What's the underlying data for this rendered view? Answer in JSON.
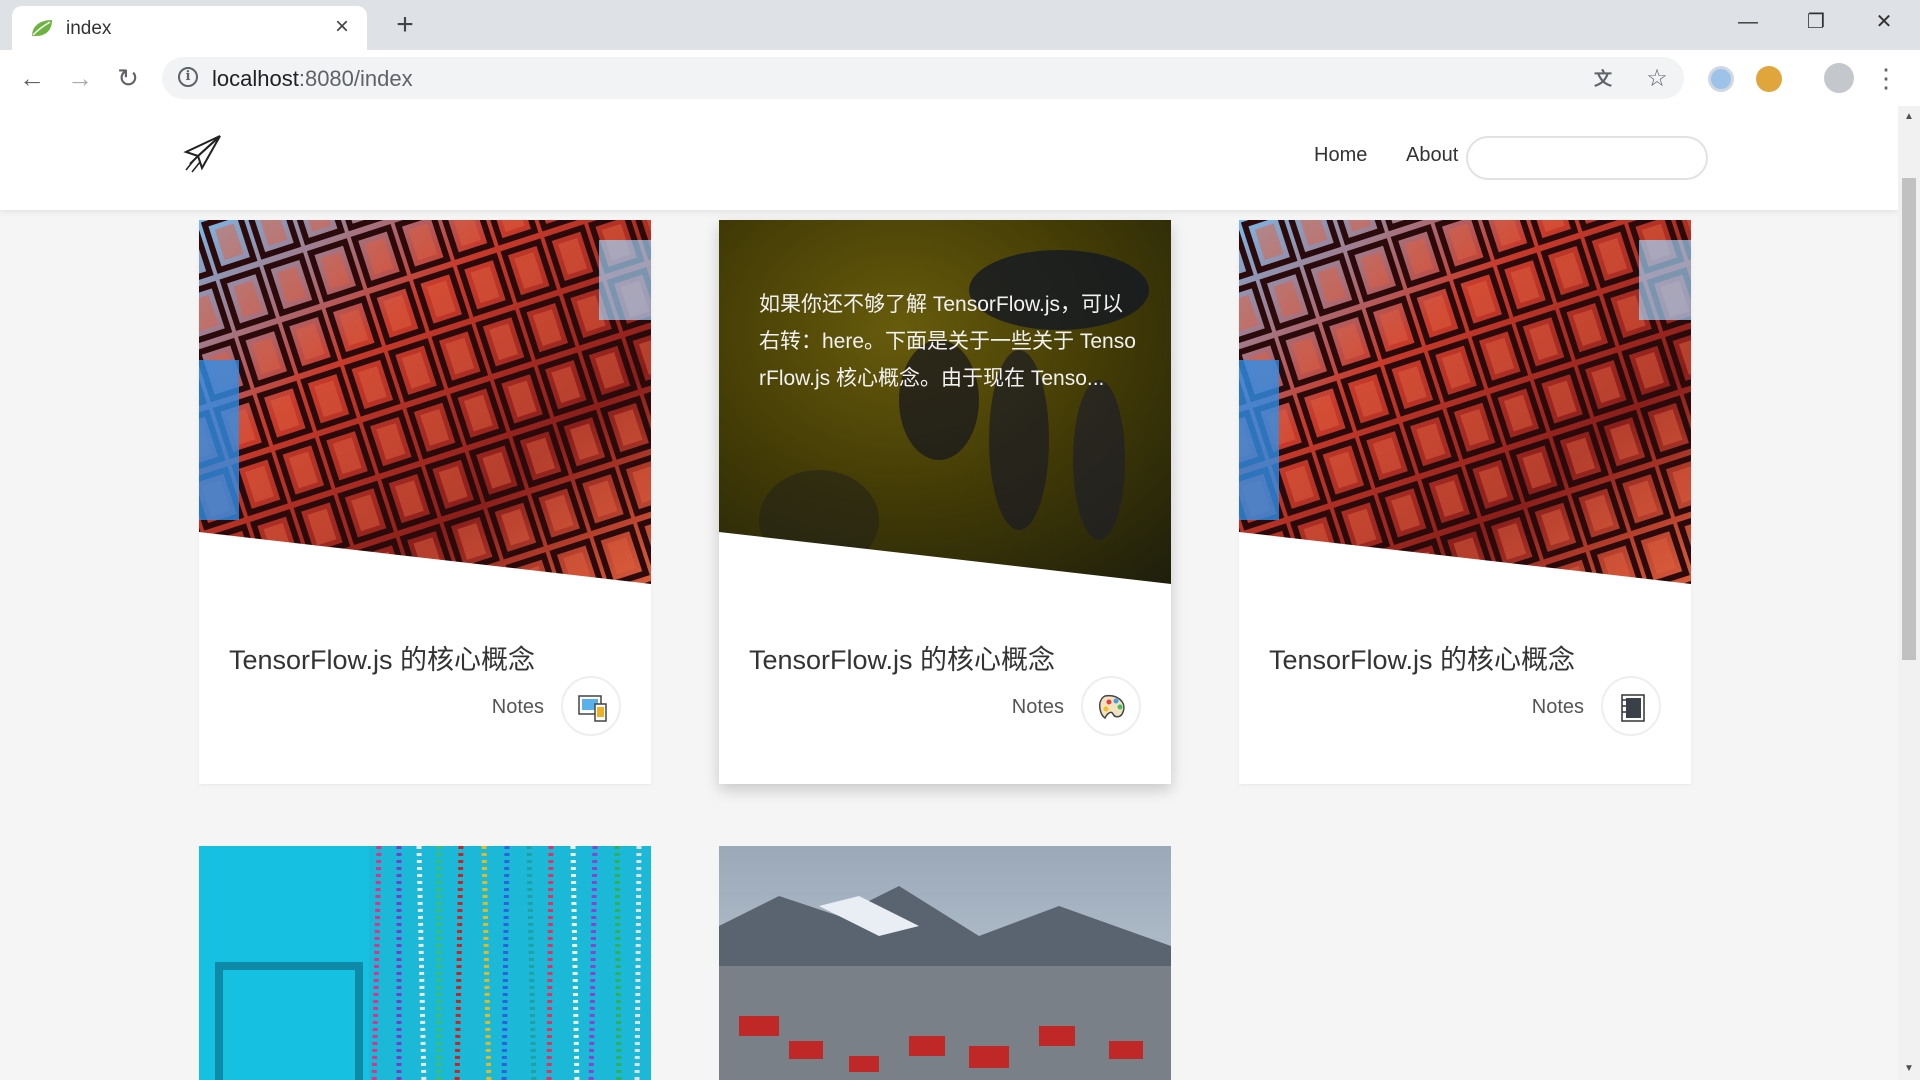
{
  "browser": {
    "tab_title": "index",
    "url_host": "localhost",
    "url_rest": ":8080/index"
  },
  "site": {
    "nav": {
      "home": "Home",
      "about": "About"
    },
    "search_placeholder": ""
  },
  "cards": [
    {
      "title": "TensorFlow.js 的核心概念",
      "tag": "Notes",
      "excerpt": "",
      "icon": "devices-icon"
    },
    {
      "title": "TensorFlow.js 的核心概念",
      "tag": "Notes",
      "excerpt": "如果你还不够了解 TensorFlow.js，可以右转：here。下面是关于一些关于 TensorFlow.js 核心概念。由于现在 Tenso...",
      "icon": "palette-icon"
    },
    {
      "title": "TensorFlow.js 的核心概念",
      "tag": "Notes",
      "excerpt": "",
      "icon": "notebook-icon"
    }
  ],
  "colors": {
    "brand_green": "#6db33f",
    "page_bg": "#f5f5f5",
    "text": "#333333"
  }
}
